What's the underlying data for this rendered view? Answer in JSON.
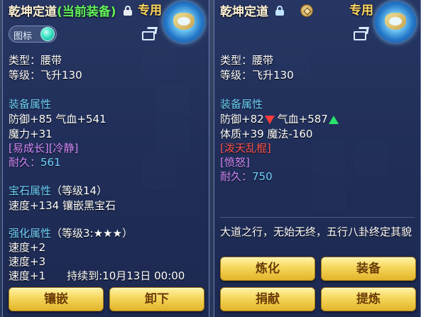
{
  "left": {
    "title_name": "乾坤定道",
    "title_tag": "(当前装备)",
    "special": "专用",
    "toggle_label": "图标",
    "type_line": "类型：腰带",
    "level_line": "等级：飞升130",
    "equip_attr_title": "装备属性",
    "attr1": "防御+85 气血+541",
    "attr2": "魔力+31",
    "skills": "[易成长][冷静]",
    "durability_label": "耐久：",
    "durability_value": "561",
    "gem_title": "宝石属性",
    "gem_level": "（等级14）",
    "gem_line": "速度+134 镶嵌黑宝石",
    "enhance_title": "强化属性",
    "enhance_level": "（等级3:★★★）",
    "enh1": "速度+2",
    "enh2": "速度+3",
    "enh3": "速度+1",
    "enh3_extra": "持续到:10月13日 00:00",
    "btn_inlay": "镶嵌",
    "btn_unequip": "卸下"
  },
  "right": {
    "title_name": "乾坤定道",
    "special": "专用",
    "type_line": "类型：腰带",
    "level_line": "等级：飞升130",
    "equip_attr_title": "装备属性",
    "attr1_a": "防御+82",
    "attr1_b": "气血+587",
    "attr2": "体质+39 魔法-160",
    "skill1": "[泼天乱棍]",
    "skill2": "[愤怒]",
    "durability_label": "耐久：",
    "durability_value": "750",
    "description": "大道之行，无始无终，五行八卦终定其貌",
    "btn_refine": "炼化",
    "btn_equip": "装备",
    "btn_donate": "捐献",
    "btn_extract": "提炼"
  },
  "colors": {
    "section": "#6fd3ff",
    "skill": "#d68cff",
    "special": "#ffd860",
    "current_tag": "#62f25a",
    "down_arrow": "#ff3b3b",
    "up_arrow": "#29e36b",
    "button": "#f5d65a"
  },
  "icons": [
    "lock-icon",
    "emblem-icon",
    "share-icon",
    "coin-icon",
    "arrow-down-icon",
    "arrow-up-icon"
  ]
}
